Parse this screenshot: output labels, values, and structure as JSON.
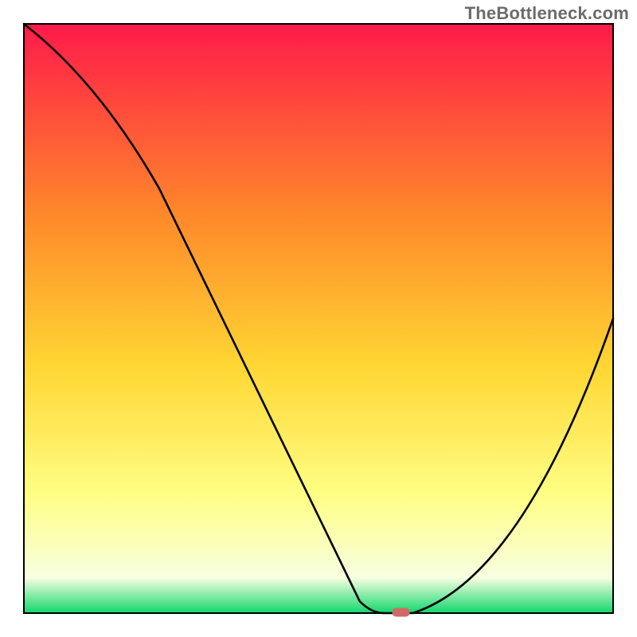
{
  "watermark": "TheBottleneck.com",
  "chart_data": {
    "type": "line",
    "title": "",
    "xlabel": "",
    "ylabel": "",
    "xlim": [
      0,
      100
    ],
    "ylim": [
      0,
      100
    ],
    "grid": false,
    "legend": false,
    "x": [
      0,
      23,
      57,
      61,
      66,
      100
    ],
    "values": [
      100,
      72,
      2,
      0,
      0,
      50
    ],
    "marker": {
      "x": 64,
      "y": 0,
      "color": "#cf6a66"
    },
    "background_gradient": {
      "top": "#ff1a4a",
      "upper_mid": "#ff8a2a",
      "mid": "#ffd633",
      "lower_mid": "#ffff85",
      "lower": "#f7ffe0",
      "base_green": "#12d66c"
    },
    "frame_color": "#000000"
  }
}
